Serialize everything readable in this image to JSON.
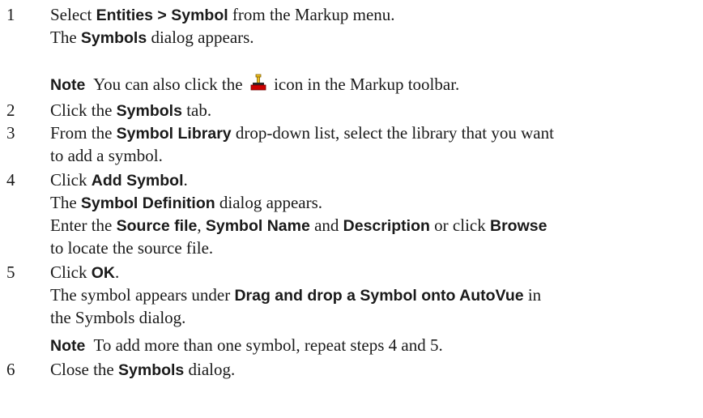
{
  "steps": [
    {
      "number": "1",
      "line1": {
        "t1": "Select ",
        "b1": "Entities > Symbol",
        "t2": " from the Markup menu."
      },
      "line2": {
        "t1": "The ",
        "b1": "Symbols",
        "t2": " dialog appears."
      },
      "note": {
        "label": "Note",
        "t1": "  You can also click the ",
        "t2": " icon in the Markup toolbar."
      }
    },
    {
      "number": "2",
      "line1": {
        "t1": "Click the ",
        "b1": "Symbols",
        "t2": " tab."
      }
    },
    {
      "number": "3",
      "line1": {
        "t1": "From the ",
        "b1": "Symbol Library",
        "t2": " drop-down list, select the library that you want"
      },
      "line2": "to add a symbol."
    },
    {
      "number": "4",
      "line1": {
        "t1": "Click ",
        "b1": "Add Symbol",
        "t2": "."
      },
      "line2": {
        "t1": "The ",
        "b1": "Symbol Definition",
        "t2": " dialog appears."
      },
      "line3": {
        "t1": "Enter the ",
        "b1": "Source file",
        "t2": ", ",
        "b2": "Symbol Name",
        "t3": " and ",
        "b3": "Description",
        "t4": " or click ",
        "b4": "Browse"
      },
      "line4": "to locate the source file."
    },
    {
      "number": "5",
      "line1": {
        "t1": "Click ",
        "b1": "OK",
        "t2": "."
      },
      "line2": {
        "t1": "The symbol appears under ",
        "b1": "Drag and drop a Symbol onto AutoVue",
        "t2": " in"
      },
      "line3": "the Symbols dialog.",
      "note": {
        "label": "Note",
        "t1": "  To add more than one symbol, repeat steps 4 and 5."
      }
    },
    {
      "number": "6",
      "line1": {
        "t1": "Close the ",
        "b1": "Symbols",
        "t2": " dialog."
      }
    }
  ],
  "icon": "stamp-icon",
  "colors": {
    "text": "#1a1a1a",
    "icon_red": "#cc0000",
    "icon_yellow": "#f0c020"
  }
}
